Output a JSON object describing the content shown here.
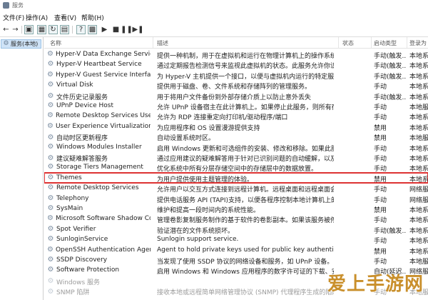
{
  "window": {
    "title": "服务"
  },
  "menu": [
    "文件(F)",
    "操作(A)",
    "查看(V)",
    "帮助(H)"
  ],
  "tree": {
    "root_label": "服务(本地)"
  },
  "columns": {
    "name": "名称",
    "desc": "描述",
    "state": "状态",
    "start": "启动类型",
    "logon": "登录为"
  },
  "rows": [
    {
      "name": "Hyper-V Data Exchange Service",
      "desc": "提供一种机制，用于在虚拟机和运行在物理计算机上的操作系统之...",
      "state": "",
      "start": "手动(触发...",
      "logon": "本地系统"
    },
    {
      "name": "Hyper-V Heartbeat Service",
      "desc": "通过定期报告检测信号来监视此虚拟机的状态。此服务允许你识别...",
      "state": "",
      "start": "手动(触发...",
      "logon": "本地系统"
    },
    {
      "name": "Hyper-V Guest Service Interface",
      "desc": "为 Hyper-V 主机提供一个接口，以便与虚拟机内运行的特定服务...",
      "state": "",
      "start": "手动(触发...",
      "logon": "本地系统"
    },
    {
      "name": "Virtual Disk",
      "desc": "提供用于磁盘、卷、文件系统和存储阵列的管理服务。",
      "state": "",
      "start": "手动",
      "logon": "本地系统"
    },
    {
      "name": "文件历史记录服务",
      "desc": "用于将用户文件备份到外部存储介质上以防止意外丢失",
      "state": "",
      "start": "手动(触发...",
      "logon": "本地系统"
    },
    {
      "name": "UPnP Device Host",
      "desc": "允许 UPnP 设备宿主在此计算机上。如果停止此服务，则所有宿主...",
      "state": "",
      "start": "手动",
      "logon": "本地服务"
    },
    {
      "name": "Remote Desktop Services User...",
      "desc": "允许为 RDP 连接重定向打印机/驱动程序/端口",
      "state": "",
      "start": "手动",
      "logon": "本地系统"
    },
    {
      "name": "User Experience Virtualization S...",
      "desc": "为应用程序和 OS 设置漫游提供支持",
      "state": "",
      "start": "禁用",
      "logon": "本地系统"
    },
    {
      "name": "自动时区更新程序",
      "desc": "自动设置系统时区。",
      "state": "",
      "start": "禁用",
      "logon": "本地服务"
    },
    {
      "name": "Windows Modules Installer",
      "desc": "启用 Windows 更新和可选组件的安装、修改和移除。如果此服务被...",
      "state": "",
      "start": "手动",
      "logon": "本地系统"
    },
    {
      "name": "建议疑难解答服务",
      "desc": "通过应用建议的疑难解答用于针对已识别问题的自动缓解，以及...",
      "state": "",
      "start": "手动",
      "logon": "本地系统"
    },
    {
      "name": "Storage Tiers Management",
      "desc": "优化系统中所有分层存储空间中的存储层中的数据放置。",
      "state": "",
      "start": "手动",
      "logon": "本地系统"
    },
    {
      "name": "Themes",
      "desc": "为用户提供使用主题管理的体验。",
      "state": "",
      "start": "禁用",
      "logon": "本地系统"
    },
    {
      "name": "Remote Desktop Services",
      "desc": "允许用户以交互方式连接到远程计算机。远程桌面和远程桌面会话...",
      "state": "",
      "start": "手动",
      "logon": "网络服务"
    },
    {
      "name": "Telephony",
      "desc": "提供电话服务 API (TAPI)支持，以便各程序控制本地计算机上的电...",
      "state": "",
      "start": "手动",
      "logon": "网络服务"
    },
    {
      "name": "SysMain",
      "desc": "维护和提高一段时间内的系统性能。",
      "state": "",
      "start": "禁用",
      "logon": "本地系统"
    },
    {
      "name": "Microsoft Software Shadow Co...",
      "desc": "管理卷影复制服务制作的基于软件的卷影副本。如果该服务被停止...",
      "state": "",
      "start": "手动",
      "logon": "本地系统"
    },
    {
      "name": "Spot Verifier",
      "desc": "验证潜在的文件系统损坏。",
      "state": "",
      "start": "手动(触发...",
      "logon": "本地系统"
    },
    {
      "name": "SunloginService",
      "desc": "Sunlogin support service.",
      "state": "",
      "start": "手动",
      "logon": "本地系统"
    },
    {
      "name": "OpenSSH Authentication Agent",
      "desc": "Agent to hold private keys used for public key authentication.",
      "state": "",
      "start": "禁用",
      "logon": "本地系统"
    },
    {
      "name": "SSDP Discovery",
      "desc": "当发现了使用 SSDP 协议的网络设备和服务，如 UPnP 设备。同时...",
      "state": "",
      "start": "手动",
      "logon": "本地服务"
    },
    {
      "name": "Software Protection",
      "desc": "启用 Windows 和 Windows 应用程序的数字许可证的下载、安装和...",
      "state": "",
      "start": "自动(延迟...",
      "logon": "网络服务"
    },
    {
      "name": "Windows 服务",
      "desc": "",
      "state": "",
      "start": "",
      "logon": ""
    },
    {
      "name": "SNMP 陷阱",
      "desc": "接收本地或远程简单网络管理协议 (SNMP) 代理程序生成的陷阱...",
      "state": "",
      "start": "手动",
      "logon": "本地服务"
    }
  ],
  "watermark": "爱上手游网"
}
